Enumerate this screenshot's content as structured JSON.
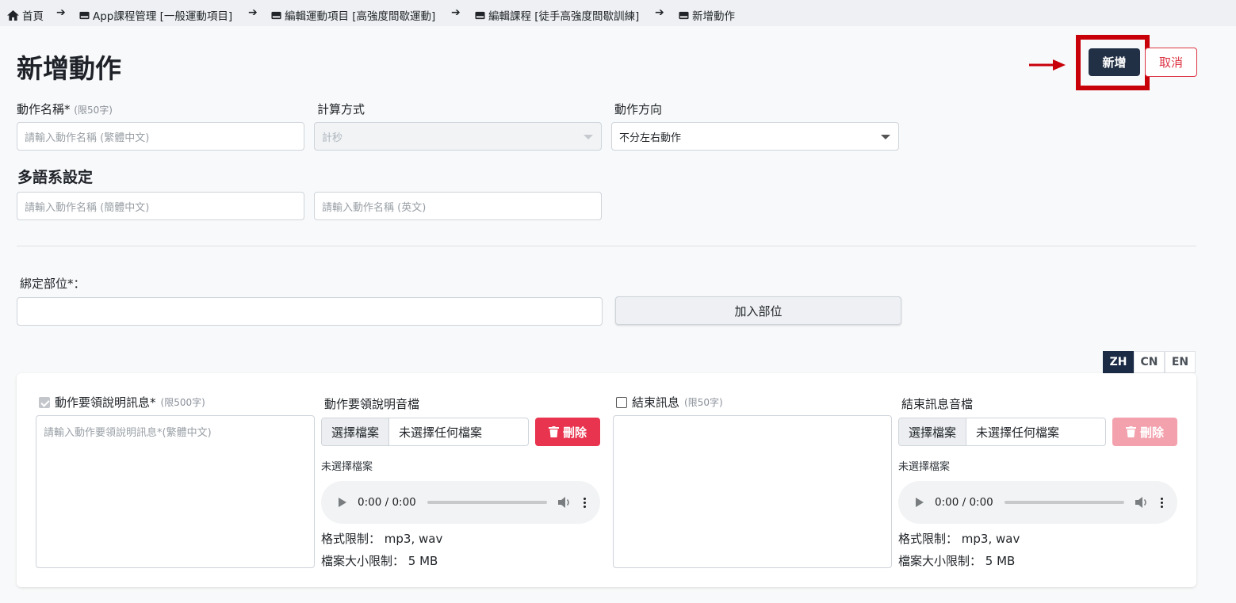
{
  "breadcrumb": {
    "home": "首頁",
    "item1": "App課程管理 [一般運動項目]",
    "item2": "編輯運動項目 [高強度間歇運動]",
    "item3": "編輯課程 [徒手高強度間歇訓練]",
    "item4": "新增動作"
  },
  "page_title": "新增動作",
  "actions": {
    "add_label": "新增",
    "cancel_label": "取消"
  },
  "form": {
    "name_label": "動作名稱*",
    "name_hint": "(限50字)",
    "name_placeholder": "請輸入動作名稱 (繁體中文)",
    "calc_label": "計算方式",
    "calc_value": "計秒",
    "direction_label": "動作方向",
    "direction_value": "不分左右動作",
    "multilang_heading": "多語系設定",
    "name_cn_placeholder": "請輸入動作名稱 (簡體中文)",
    "name_en_placeholder": "請輸入動作名稱 (英文)",
    "bind_label": "綁定部位*：",
    "bind_value": "",
    "join_button": "加入部位"
  },
  "lang_tabs": [
    "ZH",
    "CN",
    "EN"
  ],
  "lang_active": "ZH",
  "card": {
    "desc_label": "動作要領說明訊息*",
    "desc_hint": "(限500字)",
    "desc_placeholder": "請輸入動作要領說明訊息*(繁體中文)",
    "desc_checked": true,
    "desc_audio": {
      "title": "動作要領說明音檔",
      "choose": "選擇檔案",
      "no_file": "未選擇任何檔案",
      "delete": "刪除",
      "status": "未選擇檔案",
      "time": "0:00 / 0:00",
      "format": "格式限制： mp3, wav",
      "size": "檔案大小限制： 5 MB"
    },
    "end_label": "結束訊息",
    "end_hint": "(限50字)",
    "end_checked": false,
    "end_audio": {
      "title": "結束訊息音檔",
      "choose": "選擇檔案",
      "no_file": "未選擇任何檔案",
      "delete": "刪除",
      "status": "未選擇檔案",
      "time": "0:00 / 0:00",
      "format": "格式限制： mp3, wav",
      "size": "檔案大小限制： 5 MB"
    }
  },
  "colors": {
    "primary": "#223046",
    "danger": "#dc3545",
    "highlight": "#c8000a"
  },
  "icons": [
    "home-icon",
    "card-icon",
    "arrow-right-icon",
    "trash-icon",
    "play-icon",
    "volume-icon",
    "more-icon"
  ]
}
